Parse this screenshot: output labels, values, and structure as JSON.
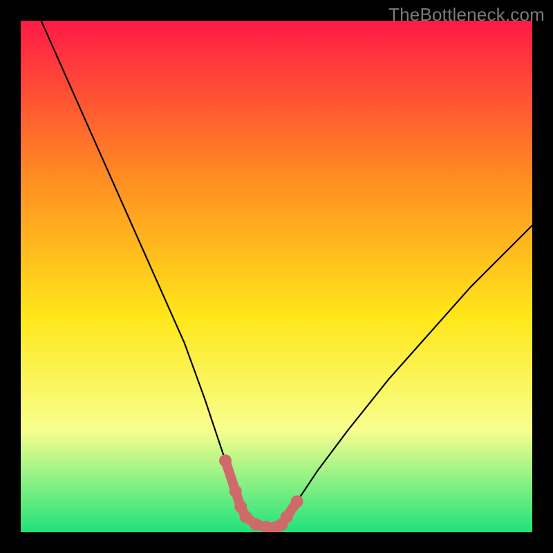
{
  "watermark": "TheBottleneck.com",
  "chart_data": {
    "type": "line",
    "title": "",
    "xlabel": "",
    "ylabel": "",
    "xlim": [
      0,
      100
    ],
    "ylim": [
      0,
      100
    ],
    "grid": false,
    "series": [
      {
        "name": "bottleneck-curve",
        "x": [
          4,
          8,
          12,
          16,
          20,
          24,
          28,
          32,
          36,
          38,
          40,
          42,
          43,
          44,
          46,
          48,
          50,
          51,
          52,
          54,
          58,
          64,
          72,
          80,
          88,
          96,
          100
        ],
        "y": [
          100,
          91,
          82,
          73,
          64,
          55,
          46,
          37,
          26,
          20,
          14,
          8,
          5,
          3,
          1.5,
          1,
          1,
          1.5,
          3,
          6,
          12,
          20,
          30,
          39,
          48,
          56,
          60
        ]
      }
    ],
    "highlight_segment": {
      "description": "valley floor markers",
      "x": [
        40,
        42,
        43,
        44,
        46,
        48,
        50,
        51,
        52,
        54
      ],
      "y": [
        14,
        8,
        5,
        3,
        1.5,
        1,
        1,
        1.5,
        3,
        6
      ]
    },
    "colors": {
      "gradient_top": "#ff1a46",
      "gradient_mid1": "#ff8a22",
      "gradient_mid2": "#ffe71a",
      "gradient_mid3": "#f8ff8e",
      "gradient_bottom": "#1fe27a",
      "curve": "#000000",
      "highlight": "#d06a6a"
    }
  }
}
